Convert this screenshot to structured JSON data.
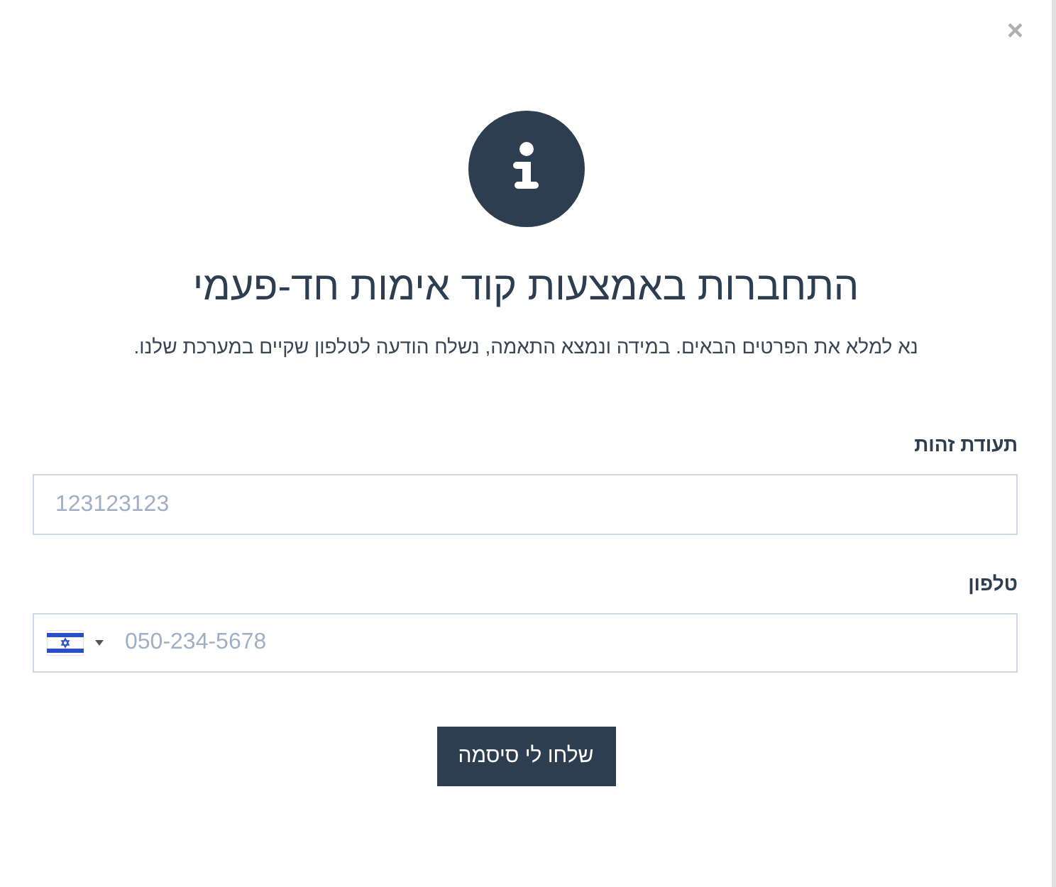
{
  "close": "×",
  "title": "התחברות באמצעות קוד אימות חד-פעמי",
  "subtitle": "נא למלא את הפרטים הבאים. במידה ונמצא התאמה, נשלח הודעה לטלפון שקיים במערכת שלנו.",
  "fields": [
    {
      "kind": "text",
      "label": "תעודת זהות",
      "placeholder": "123123123"
    },
    {
      "kind": "phone",
      "label": "טלפון",
      "placeholder": "050-234-5678"
    }
  ],
  "submit": "שלחו לי סיסמה"
}
